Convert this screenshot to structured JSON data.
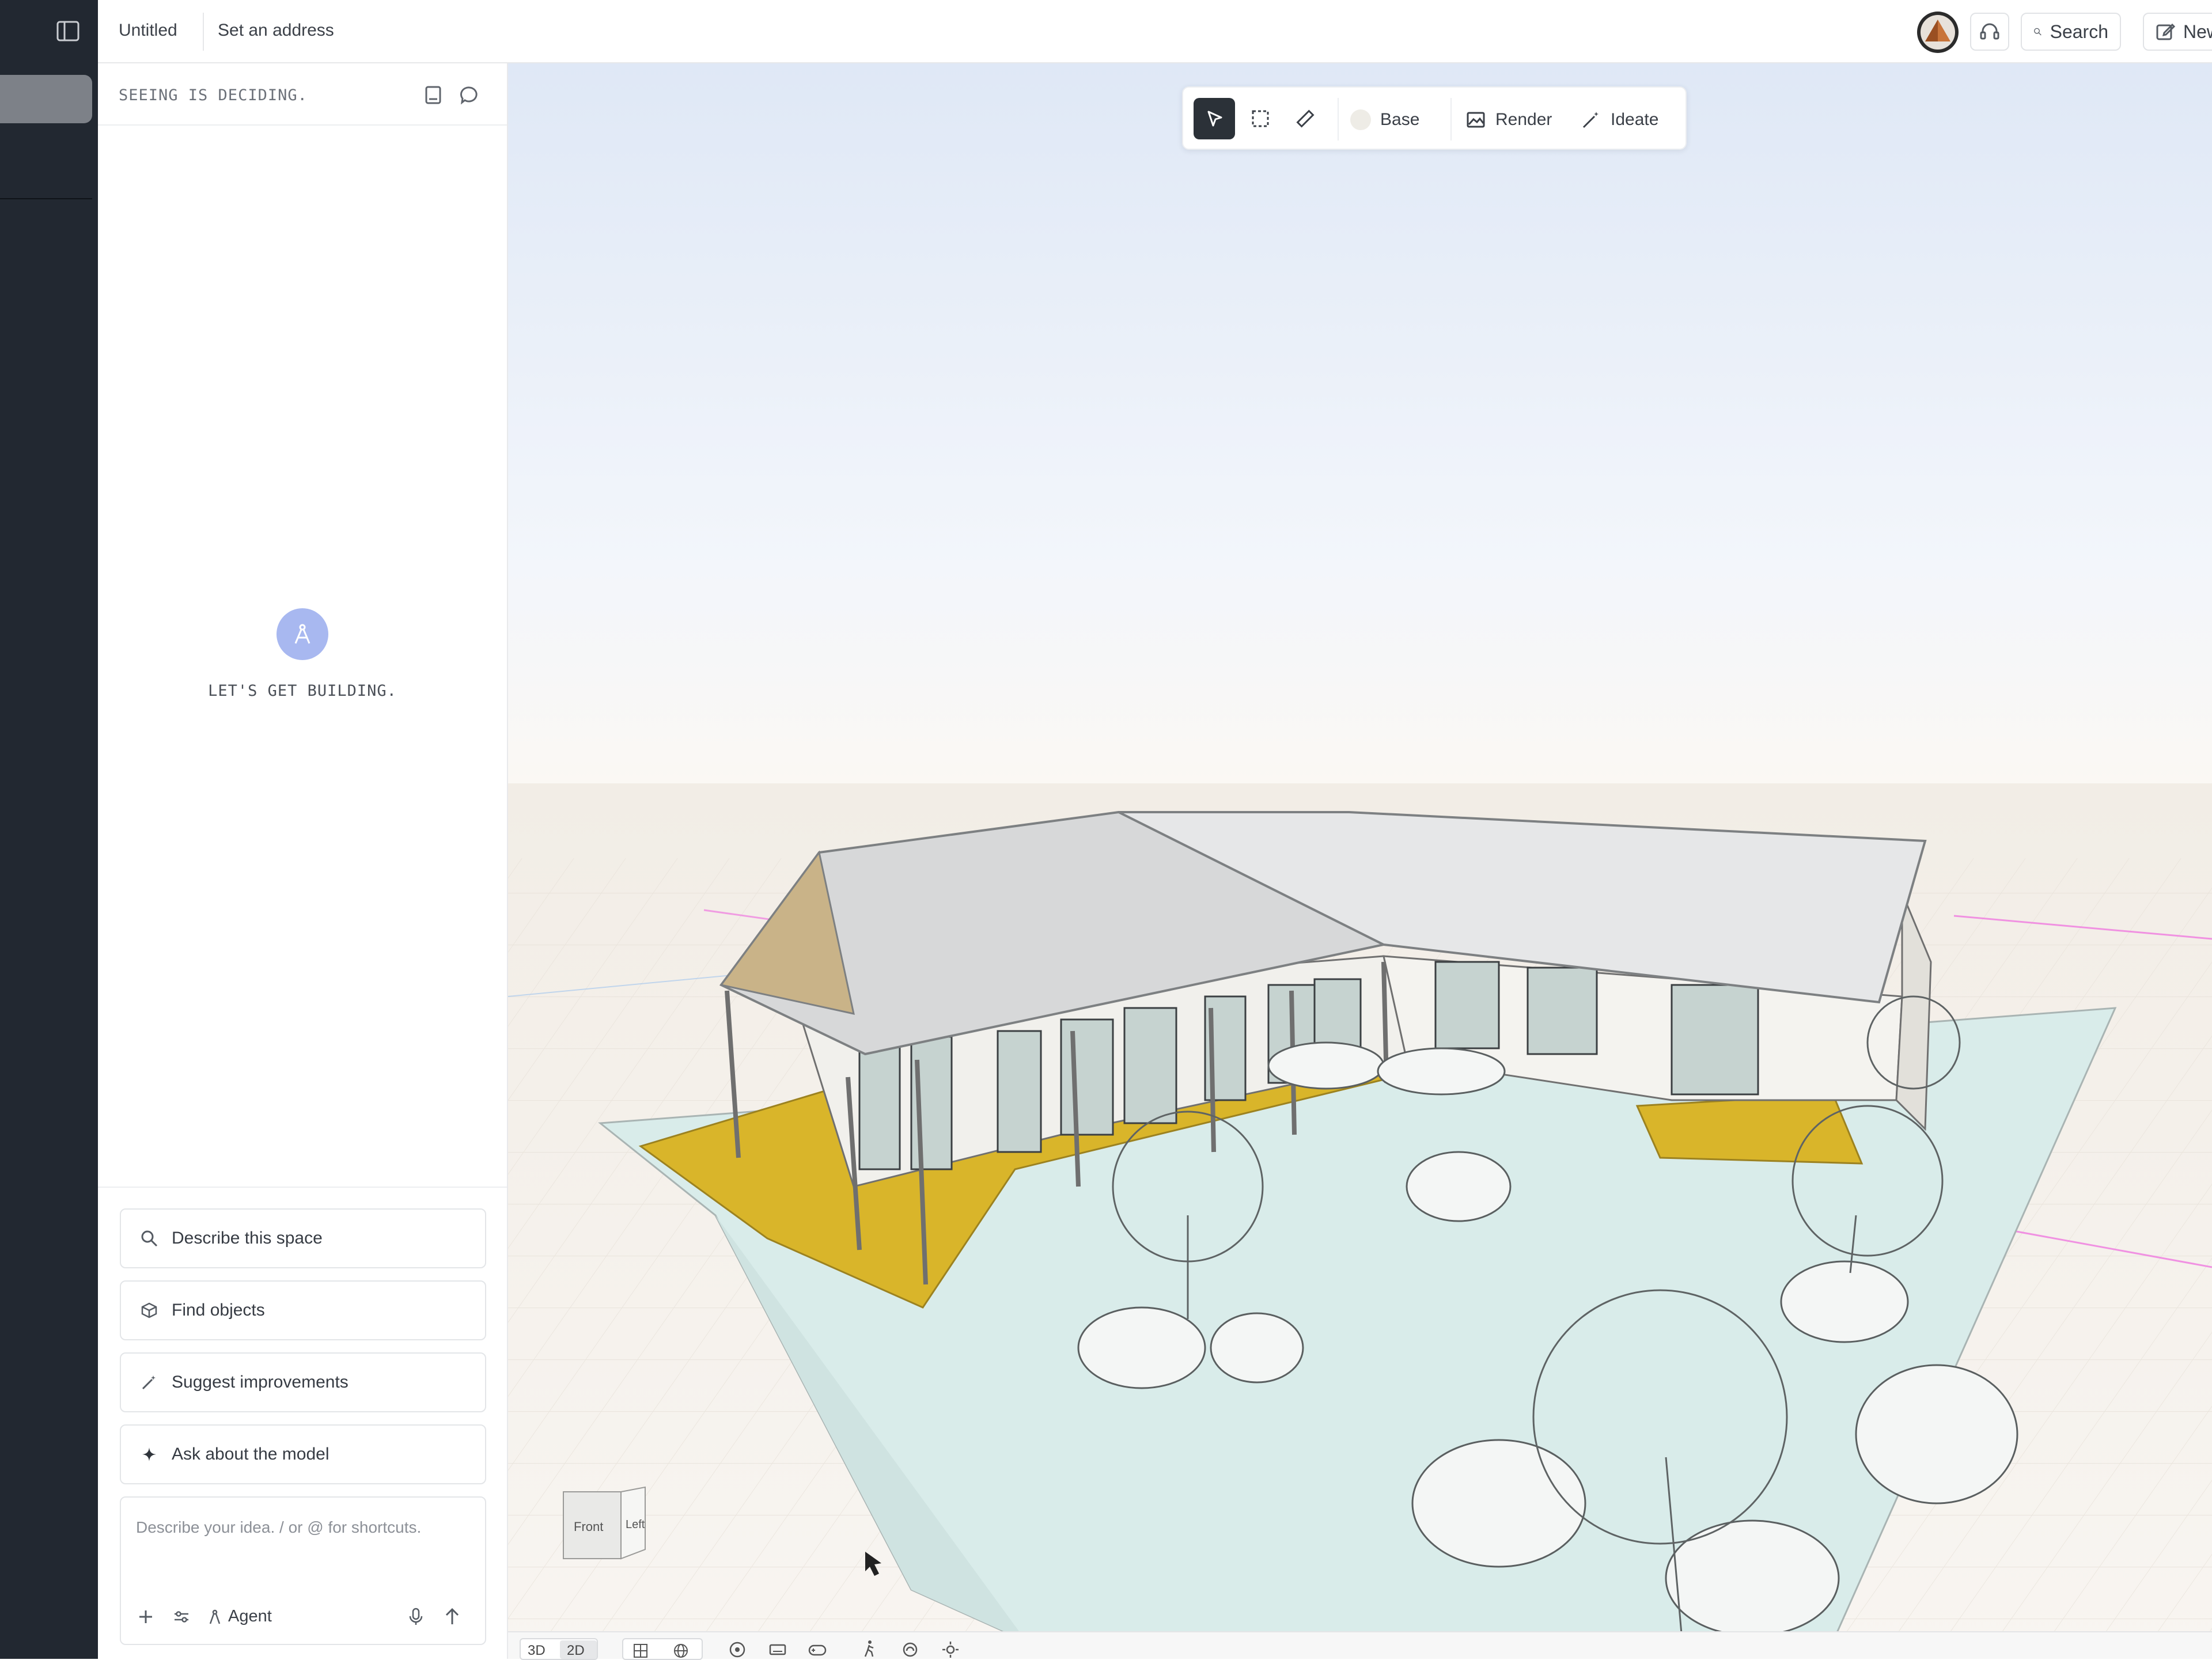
{
  "topbar": {
    "title": "Untitled",
    "address": "Set an address",
    "search_label": "Search",
    "new_label": "New"
  },
  "panel": {
    "header": "SEEING IS DECIDING.",
    "empty_state": "LET'S GET BUILDING.",
    "suggestions": [
      {
        "label": "Describe this space",
        "icon": "search-icon"
      },
      {
        "label": "Find objects",
        "icon": "cube-icon"
      },
      {
        "label": "Suggest improvements",
        "icon": "magic-wand-icon"
      },
      {
        "label": "Ask about the model",
        "icon": "sparkle-icon"
      }
    ],
    "input": {
      "placeholder": "Describe your idea. / or @ for shortcuts.",
      "mode_label": "Agent"
    }
  },
  "toolbar": {
    "base_label": "Base",
    "render_label": "Render",
    "ideate_label": "Ideate"
  },
  "viewcube": {
    "front_label": "Front",
    "left_label": "Left"
  },
  "bottombar": {
    "mode_3d": "3D",
    "mode_2d": "2D"
  },
  "colors": {
    "rail": "#222831",
    "deck": "#d9b52a",
    "accent_avatar": "#c8743a",
    "empty_icon": "#a8b8f0",
    "axis_pink": "#f07ae0"
  }
}
